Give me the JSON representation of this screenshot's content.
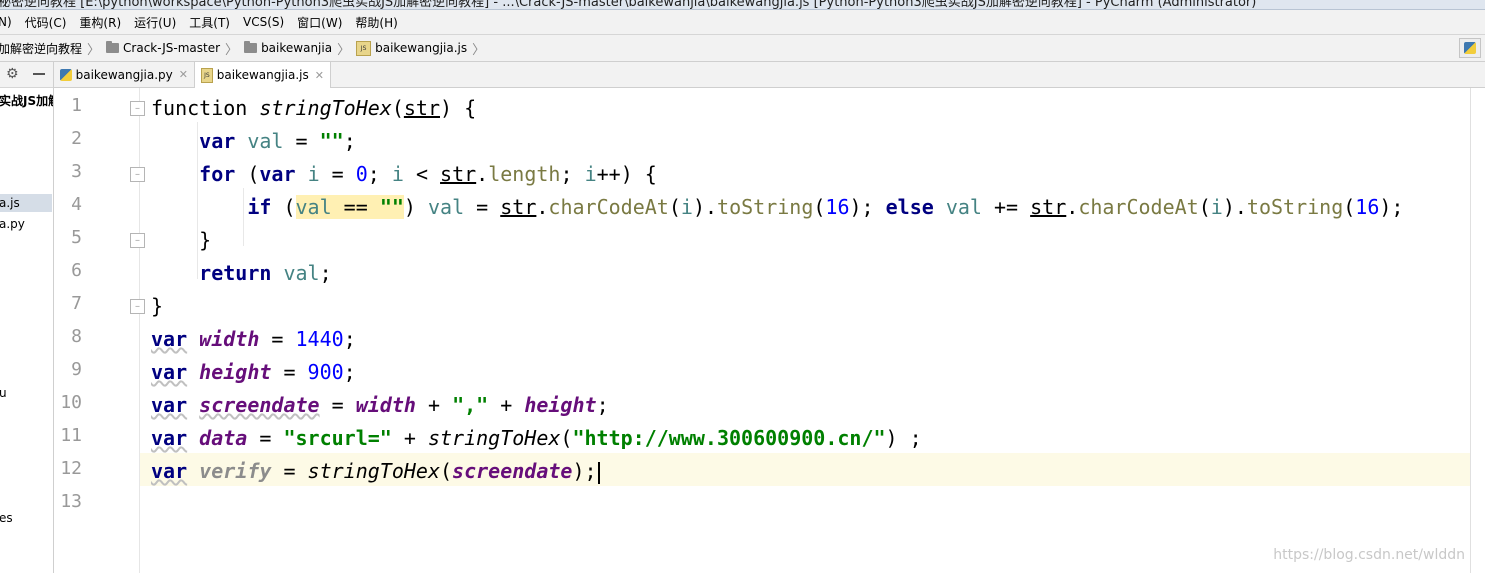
{
  "window": {
    "title": "秘密逆向教程 [E:\\python\\workspace\\Python-Python3爬虫实战JS加解密逆向教程] - ...\\Crack-JS-master\\baikewanjia\\baikewangjia.js [Python-Python3爬虫实战JS加解密逆向教程] - PyCharm (Administrator)"
  },
  "menu": [
    "N)",
    "代码(C)",
    "重构(R)",
    "运行(U)",
    "工具(T)",
    "VCS(S)",
    "窗口(W)",
    "帮助(H)"
  ],
  "breadcrumb": [
    "加解密逆向教程",
    "Crack-JS-master",
    "baikewanjia",
    "baikewangjia.js"
  ],
  "project": {
    "root": "实战JS加解",
    "items": [
      "a.js",
      "a.py",
      "u",
      "es"
    ]
  },
  "tabs": [
    {
      "label": "baikewangjia.py",
      "icon": "python-file-icon"
    },
    {
      "label": "baikewangjia.js",
      "icon": "js-file-icon"
    }
  ],
  "editor": {
    "line_numbers": [
      "1",
      "2",
      "3",
      "4",
      "5",
      "6",
      "7",
      "8",
      "9",
      "10",
      "11",
      "12",
      "13"
    ],
    "current_line": 12,
    "code": {
      "kw_function": "function",
      "fn_stringToHex": "stringToHex",
      "p_str": "str",
      "kw_var": "var",
      "kw_for": "for",
      "kw_if": "if",
      "kw_else": "else",
      "kw_return": "return",
      "v_val": "val",
      "v_i": "i",
      "m_length": "length",
      "m_charCodeAt": "charCodeAt",
      "m_toString": "toString",
      "s_empty": "\"\"",
      "s_comma": "\",\"",
      "s_srcurl": "\"srcurl=\"",
      "s_url": "\"http://www.300600900.cn/\"",
      "n_0": "0",
      "n_16": "16",
      "n_1440": "1440",
      "n_900": "900",
      "g_width": "width",
      "g_height": "height",
      "g_screendate": "screendate",
      "g_data": "data",
      "g_verify": "verify"
    }
  },
  "watermark": "https://blog.csdn.net/wlddn"
}
